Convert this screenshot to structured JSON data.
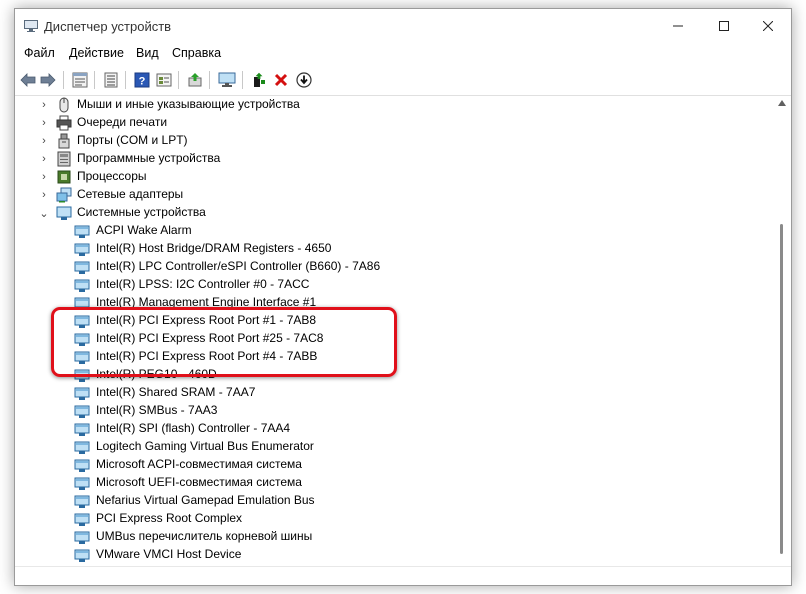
{
  "window": {
    "title": "Диспетчер устройств"
  },
  "menu": [
    "Файл",
    "Действие",
    "Вид",
    "Справка"
  ],
  "toolbar": [
    "back-icon",
    "forward-icon",
    "properties-icon",
    "device-list-icon",
    "help-icon",
    "view-icon",
    "update-driver-icon",
    "monitor-icon",
    "enable-device-icon",
    "uninstall-icon",
    "download-icon"
  ],
  "tree": {
    "categories": [
      {
        "label": "Мыши и иные указывающие устройства",
        "icon": "mouse-icon",
        "expanded": false
      },
      {
        "label": "Очереди печати",
        "icon": "printer-icon",
        "expanded": false
      },
      {
        "label": "Порты (COM и LPT)",
        "icon": "port-icon",
        "expanded": false
      },
      {
        "label": "Программные устройства",
        "icon": "software-device-icon",
        "expanded": false
      },
      {
        "label": "Процессоры",
        "icon": "processor-icon",
        "expanded": false
      },
      {
        "label": "Сетевые адаптеры",
        "icon": "network-adapter-icon",
        "expanded": false
      },
      {
        "label": "Системные устройства",
        "icon": "system-device-icon",
        "expanded": true
      }
    ],
    "system_devices": [
      "ACPI Wake Alarm",
      "Intel(R) Host Bridge/DRAM Registers - 4650",
      "Intel(R) LPC Controller/eSPI Controller (B660) - 7A86",
      "Intel(R) LPSS: I2C Controller #0 - 7ACC",
      "Intel(R) Management Engine Interface #1",
      "Intel(R) PCI Express Root Port #1 - 7AB8",
      "Intel(R) PCI Express Root Port #25 - 7AC8",
      "Intel(R) PCI Express Root Port #4 - 7ABB",
      "Intel(R) PEG10 - 460D",
      "Intel(R) Shared SRAM - 7AA7",
      "Intel(R) SMBus - 7AA3",
      "Intel(R) SPI (flash) Controller - 7AA4",
      "Logitech Gaming Virtual Bus Enumerator",
      "Microsoft ACPI-совместимая система",
      "Microsoft UEFI-совместимая система",
      "Nefarius Virtual Gamepad Emulation Bus",
      "PCI Express Root Complex",
      "UMBus перечислитель корневой шины",
      "VMware VMCI Host Device"
    ]
  },
  "colors": {
    "highlight": "#e0101a",
    "uninstall": "#d41010",
    "enable": "#1a8a1a"
  }
}
